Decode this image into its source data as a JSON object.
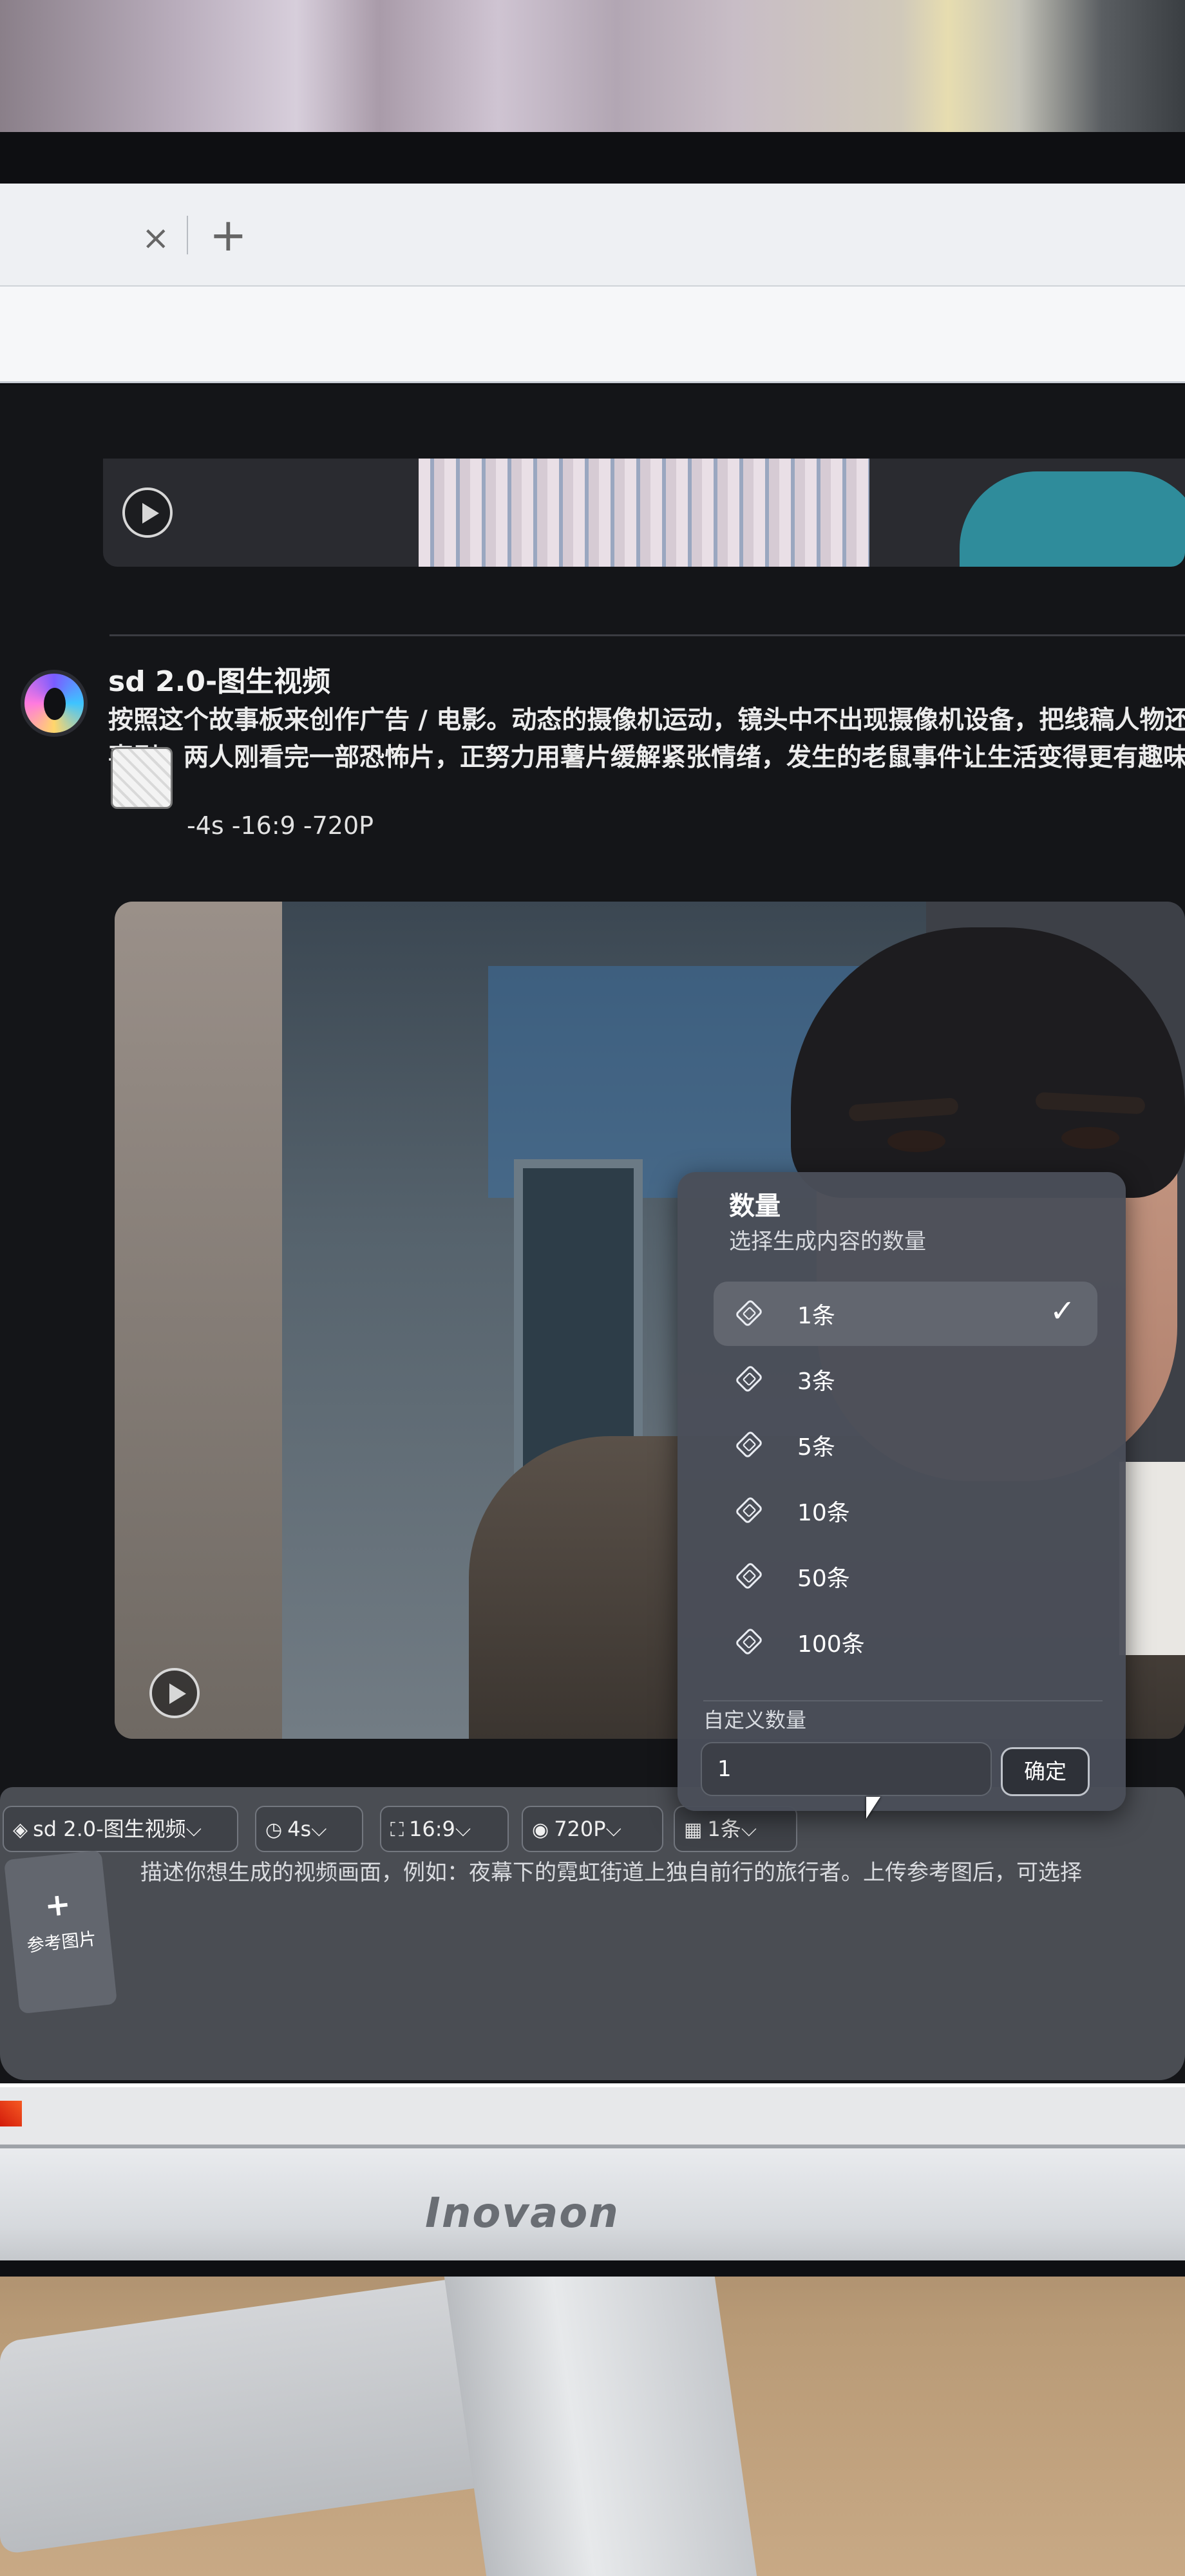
{
  "device": {
    "brand": "Inovaon"
  },
  "browser": {
    "tab_close": "×",
    "new_tab": "+"
  },
  "message": {
    "model_title": "sd 2.0-图生视频",
    "prompt_line1": "按照这个故事板来创作广告 / 电影。动态的摄像机运动，镜头中不出现摄像机设备，把线稿人物还",
    "prompt_line2": "喜剧，两人刚看完一部恐怖片，正努力用薯片缓解紧张情绪，发生的老鼠事件让生活变得更有趣味",
    "params": "-4s -16:9 -720P"
  },
  "quantity_dropdown": {
    "title": "数量",
    "subtitle": "选择生成内容的数量",
    "options": [
      {
        "label": "1条",
        "selected": true
      },
      {
        "label": "3条",
        "selected": false
      },
      {
        "label": "5条",
        "selected": false
      },
      {
        "label": "10条",
        "selected": false
      },
      {
        "label": "50条",
        "selected": false
      },
      {
        "label": "100条",
        "selected": false
      }
    ],
    "check_mark": "✓",
    "custom_label": "自定义数量",
    "custom_value": "1",
    "confirm_label": "确定"
  },
  "composer": {
    "model_chip": "sd 2.0-图生视频",
    "duration_chip": "4s",
    "ratio_chip": "16:9",
    "resolution_chip": "720P",
    "count_chip": "1条",
    "placeholder": "描述你想生成的视频画面，例如：夜幕下的霓虹街道上独自前行的旅行者。上传参考图后，可选择",
    "ref_upload_plus": "+",
    "ref_upload_label": "参考图片"
  },
  "icons": {
    "play": "play-icon",
    "timer": "timer-icon",
    "ratio": "aspect-ratio-icon",
    "eye": "eye-icon",
    "count": "count-icon",
    "chevron": "chevron-down-icon",
    "check": "check-icon",
    "layers": "layers-icon"
  },
  "colors": {
    "page_bg": "#141518",
    "dropdown_bg": "#4a4e58",
    "selected_option_bg": "#62666f",
    "composer_bg": "#4a4d53"
  }
}
